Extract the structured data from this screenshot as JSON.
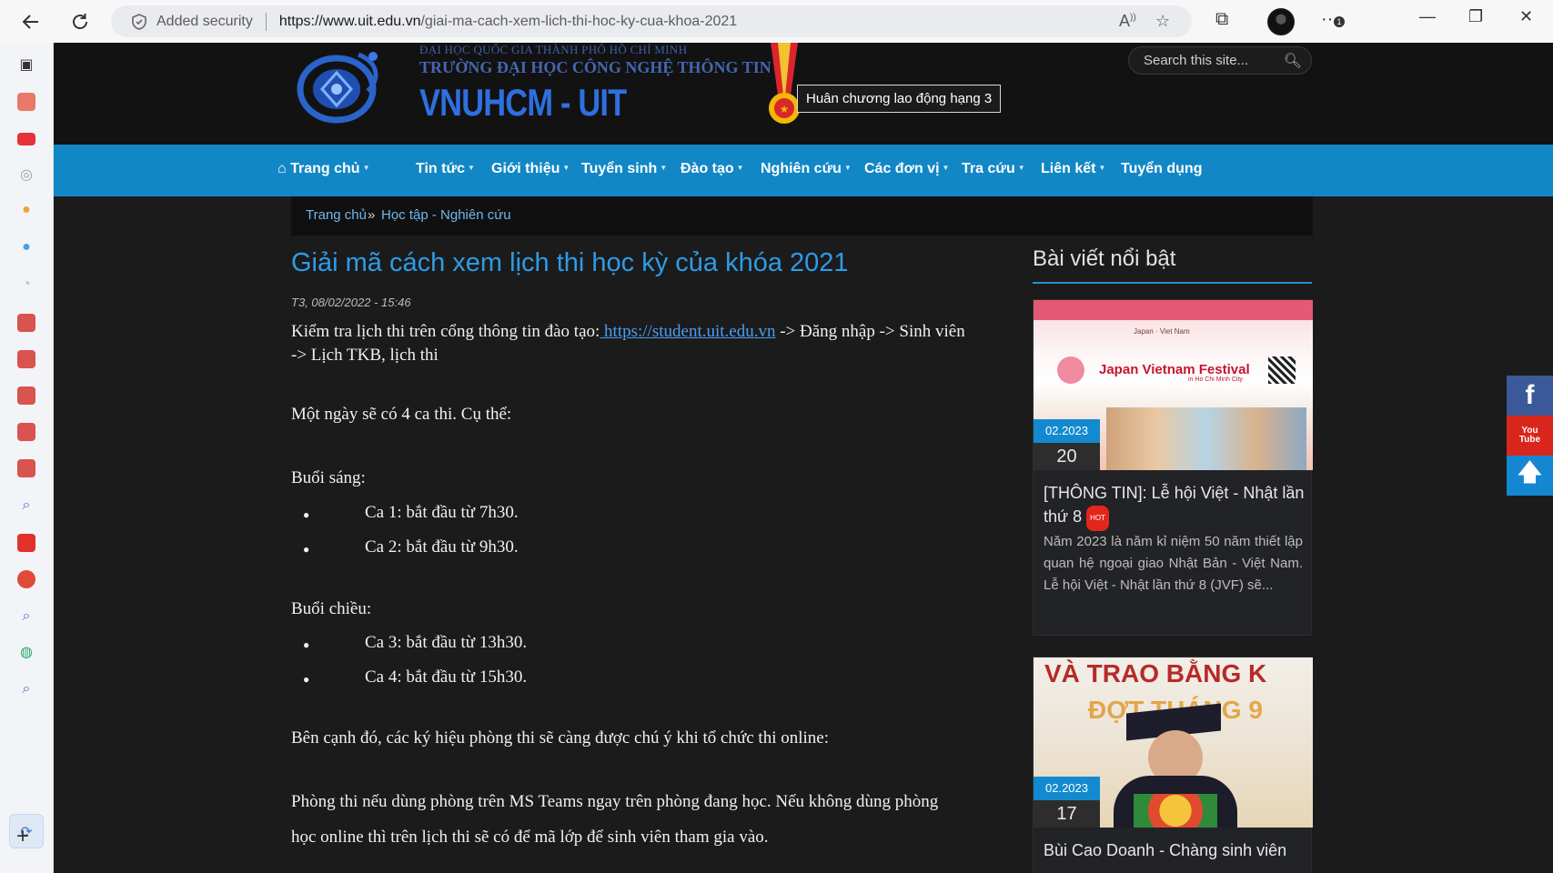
{
  "browser": {
    "security_label": "Added security",
    "url_host": "https://www.uit.edu.vn",
    "url_path": "/giai-ma-cach-xem-lich-thi-hoc-ky-cua-khoa-2021",
    "notification_badge": "1"
  },
  "header": {
    "logo_top": "ĐẠI HỌC QUỐC GIA THÀNH PHỐ HỒ CHÍ MINH",
    "logo_mid": "TRƯỜNG ĐẠI HỌC CÔNG NGHỆ THÔNG TIN",
    "logo_big": "VNUHCM - UIT",
    "medal_tooltip": "Huân chương lao động hạng 3",
    "search_placeholder": "Search this site..."
  },
  "nav": [
    {
      "label": "Trang chủ",
      "caret": true
    },
    {
      "label": "Tin tức",
      "caret": true
    },
    {
      "label": "Giới thiệu",
      "caret": true
    },
    {
      "label": "Tuyển sinh",
      "caret": true
    },
    {
      "label": "Đào tạo",
      "caret": true
    },
    {
      "label": "Nghiên cứu",
      "caret": true
    },
    {
      "label": "Các đơn vị",
      "caret": true
    },
    {
      "label": "Tra cứu",
      "caret": true
    },
    {
      "label": "Liên kết",
      "caret": true
    },
    {
      "label": "Tuyển dụng",
      "caret": false
    }
  ],
  "breadcrumb": {
    "home": "Trang chủ",
    "sep": "»",
    "current": "Học tập - Nghiên cứu"
  },
  "article": {
    "title": "Giải mã cách xem lịch thi học kỳ của khóa 2021",
    "date": "T3, 08/02/2022 - 15:46",
    "p1_before": "Kiểm tra lịch thi trên cổng thông tin đào tạo:",
    "p1_link": " https://student.uit.edu.vn",
    "p1_after": " -> Đăng nhập -> Sinh viên",
    "p1_line2": "-> Lịch TKB, lịch thi",
    "p2": "Một ngày sẽ có 4 ca thi. Cụ thể:",
    "morning": "Buổi sáng:",
    "ca1": "Ca 1: bắt đầu từ 7h30.",
    "ca2": "Ca 2: bắt đầu từ 9h30.",
    "afternoon": "Buổi chiều:",
    "ca3": "Ca 3: bắt đầu từ 13h30.",
    "ca4": "Ca 4: bắt đầu từ 15h30.",
    "p3": "Bên cạnh đó, các ký hiệu phòng thi sẽ càng được chú ý khi tổ chức thi online:",
    "p4_line1": "Phòng thi nếu dùng phòng trên MS Teams ngay trên phòng đang học. Nếu không dùng phòng",
    "p4_line2": "học online thì trên lịch thi sẽ có để mã lớp để sinh viên tham gia vào."
  },
  "sidebar_posts": {
    "heading": "Bài viết nổi bật",
    "post1": {
      "month": "02.2023",
      "day": "20",
      "title_line1": "[THÔNG TIN]: Lễ hội Việt - Nhật lần",
      "title_line2": "thứ 8",
      "badge": "HOT",
      "excerpt": "Năm 2023 là năm kỉ niệm 50 năm thiết lập quan hệ ngoại giao Nhật Bản - Việt Nam. Lễ hội Việt - Nhật lần thứ 8 (JVF) sẽ...",
      "img_text1": "Japan · Viet Nam",
      "img_text2": "Japan Vietnam Festival",
      "img_text3": "in Ho Chi Minh City"
    },
    "post2": {
      "month": "02.2023",
      "day": "17",
      "title": "Bùi Cao Doanh - Chàng sinh viên",
      "img_text1": "VÀ TRAO BẰNG K",
      "img_text2": "ĐỢT THÁNG 9"
    }
  },
  "colors": {
    "nav_bg": "#1187c6",
    "title": "#2e9be6",
    "page_bg": "#1b1b1c",
    "facebook": "#3b5998",
    "youtube": "#d9261c",
    "top": "#1587d1"
  }
}
